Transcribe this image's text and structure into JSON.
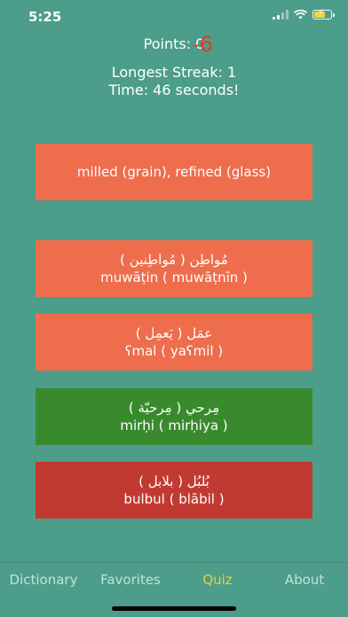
{
  "status": {
    "time": "5:25"
  },
  "score": {
    "points": "Points: 0",
    "penalty": "-6",
    "streak": "Longest Streak: 1",
    "time": "Time: 46 seconds!"
  },
  "answers": [
    {
      "text": "milled (grain), refined (glass)",
      "state": "neutral"
    },
    {
      "arabic": "مُواطِن  ( مُواطِنين  )",
      "translit": "muwāṭin ( muwāṭnīn )",
      "state": "neutral"
    },
    {
      "arabic": "عمَل  ( يَعمِل  )",
      "translit": "ʕmal ( yaʕmil )",
      "state": "neutral"
    },
    {
      "arabic": "مِرحي  ( مِرحيّة  )",
      "translit": "mirḥi ( mirḥiya )",
      "state": "correct"
    },
    {
      "arabic": "بُلبُل  ( بلابل  )",
      "translit": "bulbul ( blābil )",
      "state": "wrong"
    }
  ],
  "tabs": [
    {
      "label": "Dictionary",
      "active": false
    },
    {
      "label": "Favorites",
      "active": false
    },
    {
      "label": "Quiz",
      "active": true
    },
    {
      "label": "About",
      "active": false
    }
  ],
  "colors": {
    "background": "#4c9d8a",
    "answer_neutral": "#ee6d4d",
    "answer_correct": "#398a2d",
    "answer_wrong": "#c13a31",
    "penalty": "#e03a2a",
    "tab_active": "#f0cf3c"
  }
}
